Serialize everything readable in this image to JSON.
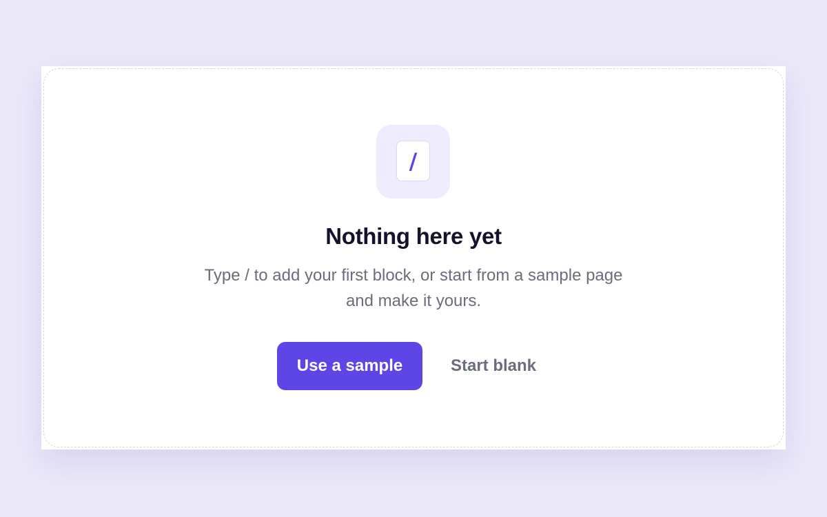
{
  "empty_state": {
    "icon": "slash-key-icon",
    "icon_glyph": "/",
    "title": "Nothing here yet",
    "description": "Type / to add your first block, or start from a sample page and make it yours."
  },
  "actions": {
    "primary_label": "Use a sample",
    "secondary_label": "Start blank"
  },
  "colors": {
    "background": "#ebe8fa",
    "accent": "#5d45e6",
    "icon_tile": "#efedfd",
    "title": "#15122b",
    "muted_text": "#6a6d7a"
  }
}
